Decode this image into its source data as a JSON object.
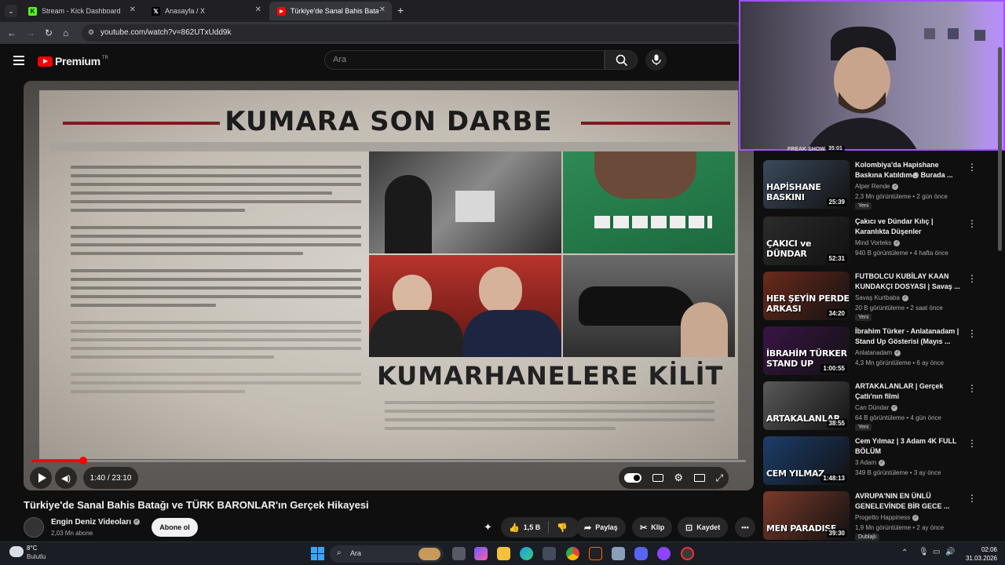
{
  "browser": {
    "tabs": [
      {
        "label": "Stream - Kick Dashboard",
        "icon": "kick-icon"
      },
      {
        "label": "Anasayfa / X",
        "icon": "x-icon"
      },
      {
        "label": "Türkiye'de Sanal Bahis Batağı ve",
        "icon": "youtube-icon"
      }
    ],
    "url": "youtube.com/watch?v=862UTxUdd9k"
  },
  "header": {
    "logo_text": "Premium",
    "logo_country": "TR",
    "search_placeholder": "Ara"
  },
  "video": {
    "headline_top": "KUMARA SON DARBE",
    "headline_bottom": "KUMARHANELERE KİLİT",
    "current_time": "1:40",
    "duration": "23:10",
    "time_display": "1:40 / 23:10",
    "progress": 0.072,
    "title": "Türkiye'de Sanal Bahis Batağı ve TÜRK BARONLAR'ın Gerçek Hikayesi",
    "channel": "Engin Deniz Videoları",
    "subscribers": "2,03 Mn abone",
    "subscribe_label": "Abone ol",
    "likes": "1,5 B",
    "share_label": "Paylaş",
    "clip_label": "Klip",
    "save_label": "Kaydet"
  },
  "webcam": {
    "overlay_label": "FREAK SHOW",
    "overlay_duration": "35:01"
  },
  "recommendations": [
    {
      "title": "Kolombiya'da Hapishane Baskına Katıldım꩜ Burada ...",
      "channel": "Alper Rende",
      "meta": "2,3 Mn görüntüleme • 2 gün önce",
      "badge": "Yeni",
      "duration": "25:39",
      "thumb_text": "HAPİSHANE BASKINI",
      "thumb_color": "#3b4a5c"
    },
    {
      "title": "Çakıcı ve Dündar Kılıç | Karanlıkta Düşenler",
      "channel": "Mind Vorteks",
      "meta": "940 B görüntüleme • 4 hafta önce",
      "badge": "",
      "duration": "52:31",
      "thumb_text": "ÇAKICI ve DÜNDAR",
      "thumb_color": "#2b2b2b"
    },
    {
      "title": "FUTBOLCU KUBİLAY KAAN KUNDAKÇI DOSYASI | Savaş ...",
      "channel": "Savaş Kurtbaba",
      "meta": "20 B görüntüleme • 2 saat önce",
      "badge": "Yeni",
      "duration": "34:20",
      "thumb_text": "HER ŞEYİN PERDE ARKASI",
      "thumb_color": "#6b2a1c"
    },
    {
      "title": "İbrahim Türker - Anlatanadam | Stand Up Gösterisi (Mayıs ...",
      "channel": "Anlatanadam",
      "meta": "4,3 Mn görüntüleme • 6 ay önce",
      "badge": "",
      "duration": "1:00:55",
      "thumb_text": "İBRAHİM TÜRKER STAND UP",
      "thumb_color": "#3a1446"
    },
    {
      "title": "ARTAKALANLAR | Gerçek Çatlı'nın filmi",
      "channel": "Can Dündar",
      "meta": "64 B görüntüleme • 4 gün önce",
      "badge": "Yeni",
      "duration": "38:55",
      "thumb_text": "ARTAKALANLAR",
      "thumb_color": "#5a5a5a"
    },
    {
      "title": "Cem Yılmaz | 3 Adam 4K FULL BÖLÜM",
      "channel": "3 Adam",
      "meta": "349 B görüntüleme • 3 ay önce",
      "badge": "",
      "duration": "1:48:13",
      "thumb_text": "CEM YILMAZ",
      "thumb_color": "#1d3d6b"
    },
    {
      "title": "AVRUPA'NIN EN ÜNLÜ GENELEVİNDE BİR GECE ...",
      "channel": "Progetto Happiness",
      "meta": "1,9 Mn görüntüleme • 2 ay önce",
      "badge": "Dublajlı",
      "duration": "39:30",
      "thumb_text": "MEN PARADISE",
      "thumb_color": "#7a3a2a"
    }
  ],
  "taskbar": {
    "temperature": "8°C",
    "condition": "Bulutlu",
    "search_label": "Ara",
    "time": "02:06",
    "date": "31.03.2026"
  },
  "colors": {
    "accent": "#ff0000",
    "webcam_border": "#a152ff",
    "background": "#0f0f0f"
  }
}
